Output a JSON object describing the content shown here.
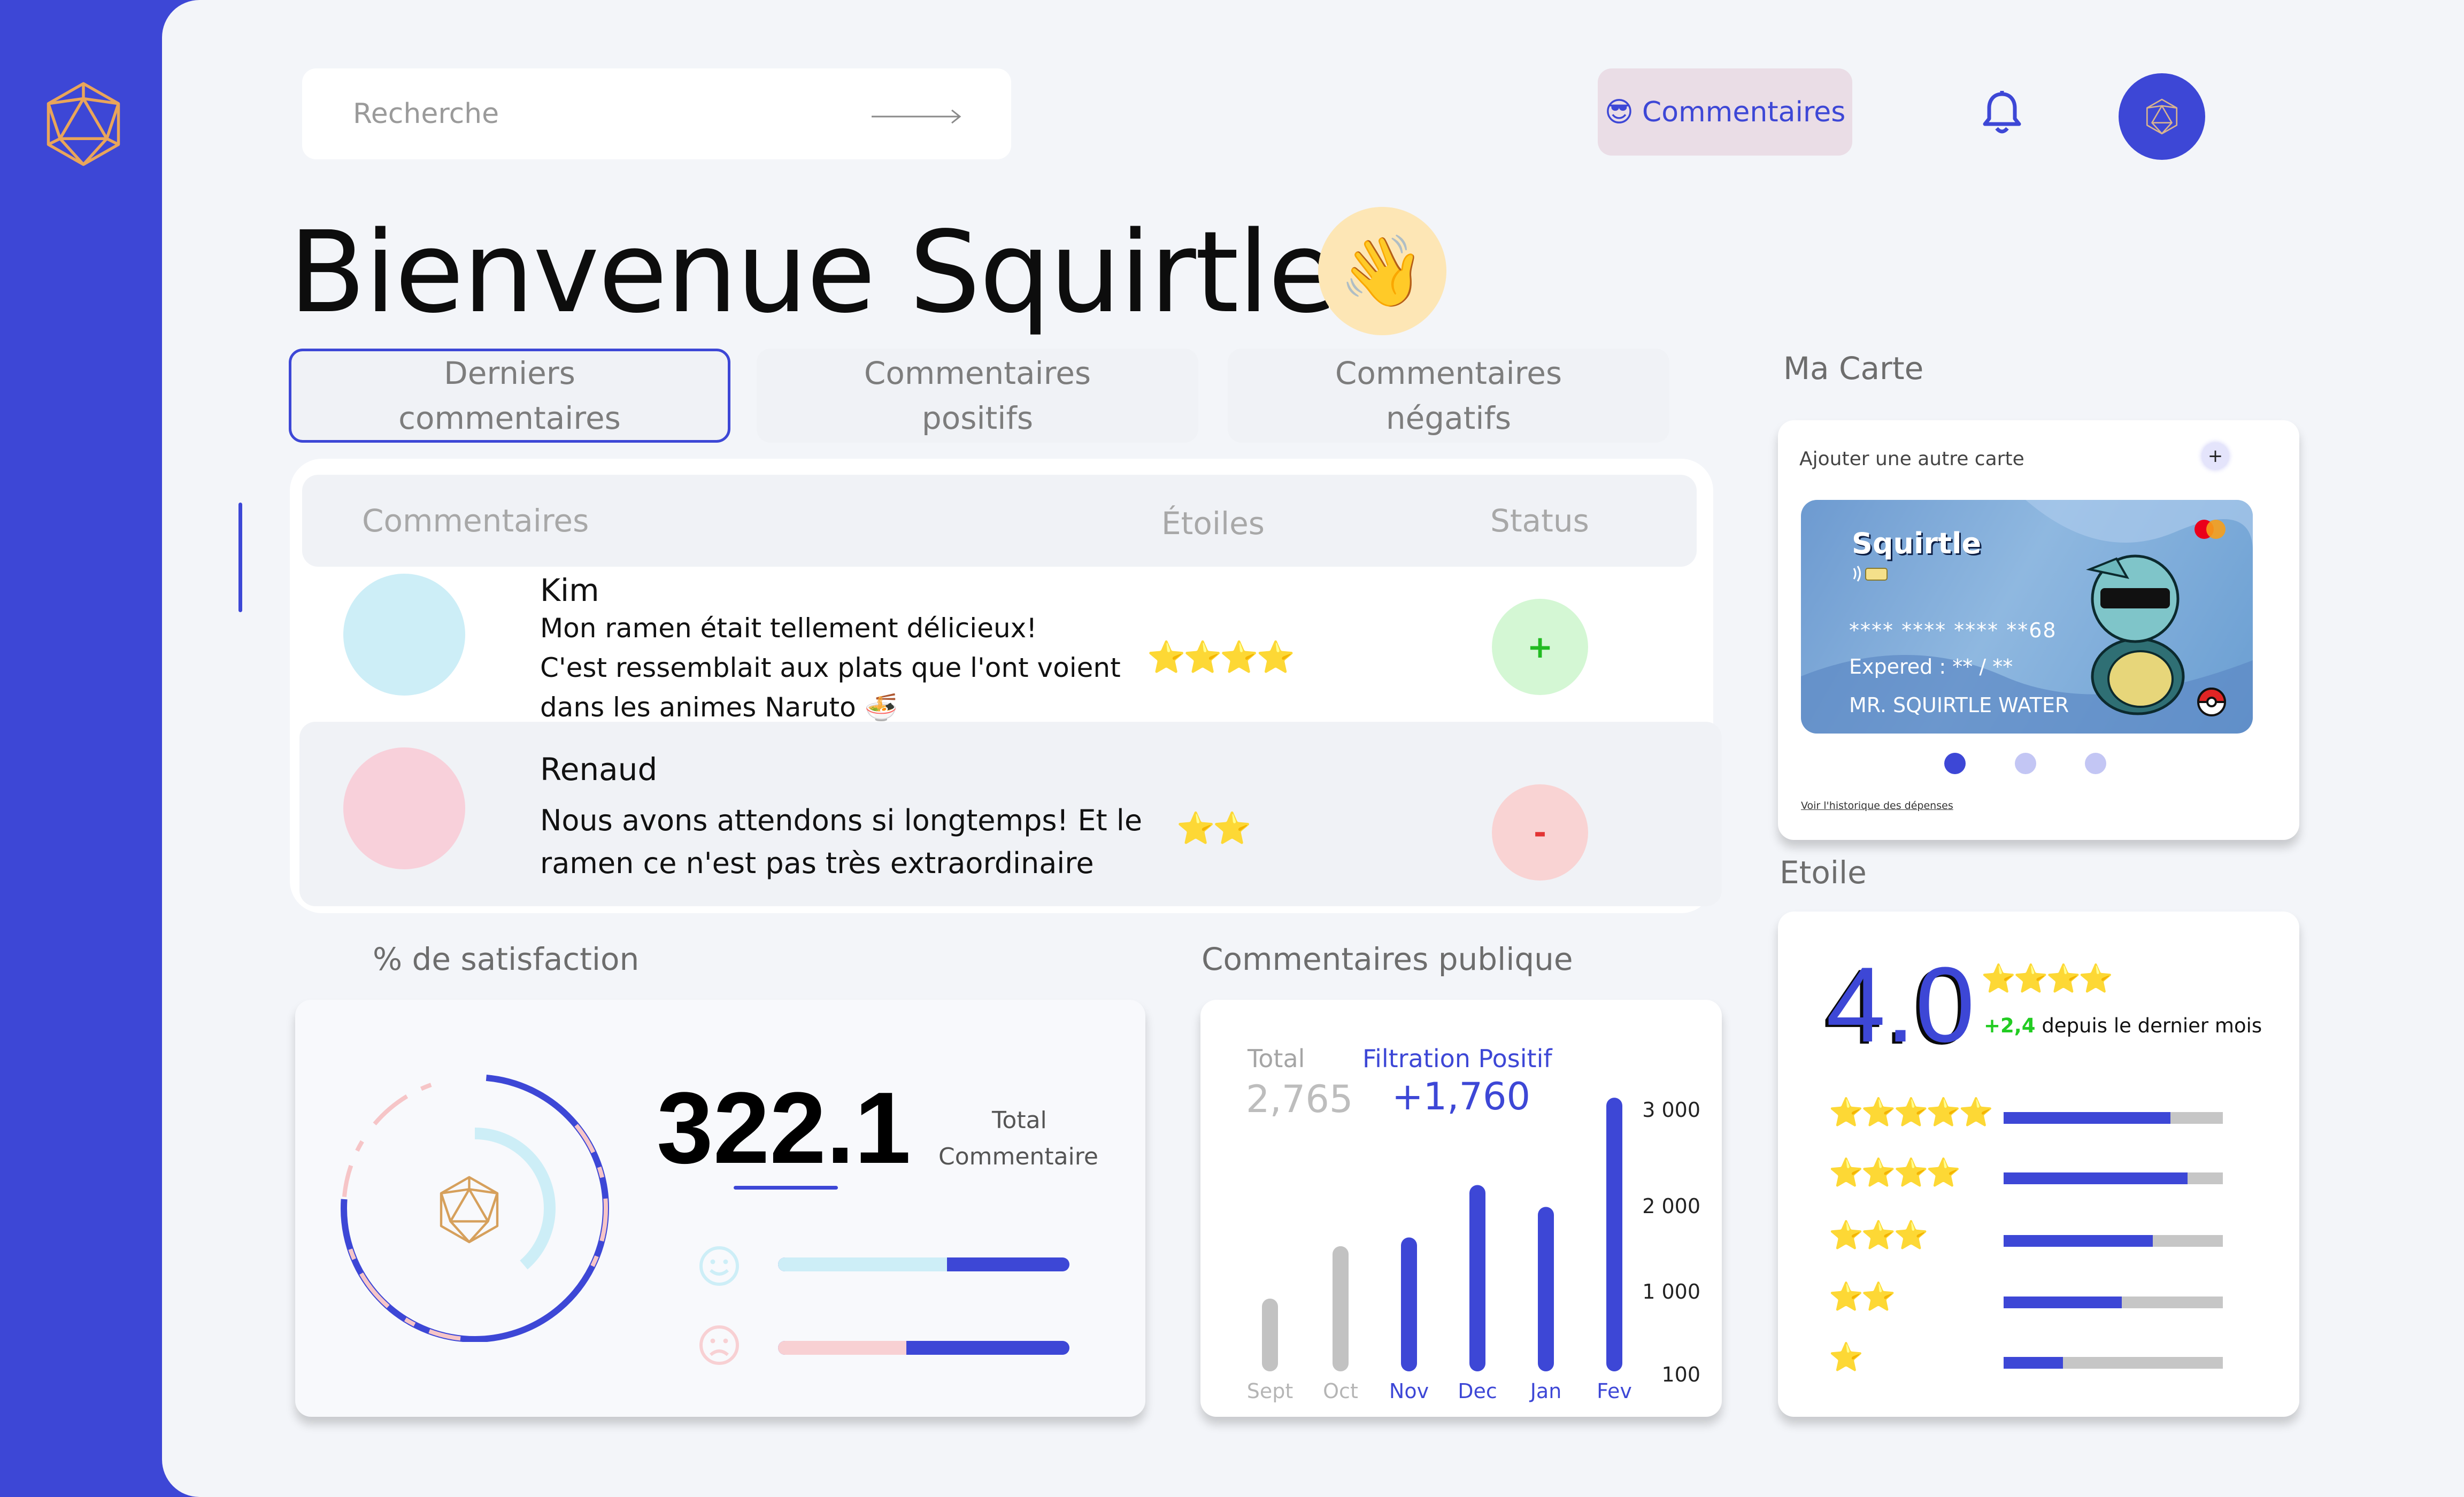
{
  "search": {
    "placeholder": "Recherche"
  },
  "header": {
    "comments_button": "Commentaires",
    "comments_emoji": "😎"
  },
  "welcome": {
    "title": "Bienvenue Squirtle !",
    "emoji": "👋"
  },
  "tabs": [
    {
      "label": "Derniers commentaires",
      "active": true
    },
    {
      "label": "Commentaires positifs",
      "active": false
    },
    {
      "label": "Commentaires négatifs",
      "active": false
    }
  ],
  "table": {
    "headers": {
      "comments": "Commentaires",
      "stars": "Étoiles",
      "status": "Status"
    },
    "rows": [
      {
        "name": "Kim",
        "comment": "Mon ramen était tellement délicieux!\nC'est ressemblait aux plats que l'ont voient\ndans les animes Naruto 🍜",
        "stars": 4,
        "status": "+",
        "avatar_color": "#cdeef7",
        "status_bg": "#d4f7d4",
        "status_color": "#22bb22"
      },
      {
        "name": "Renaud",
        "comment": "Nous avons attendons si longtemps! Et le\nramen ce n'est pas très extraordinaire",
        "stars": 2,
        "status": "-",
        "avatar_color": "#f8d0da",
        "status_bg": "#f9d3d3",
        "status_color": "#e33333"
      }
    ]
  },
  "satisfaction": {
    "label": "% de satisfaction",
    "total_value": "322.1",
    "total_label_1": "Total",
    "total_label_2": "Commentaire",
    "happy_fraction": 0.58,
    "sad_fraction": 0.44
  },
  "public_comments": {
    "label": "Commentaires publique",
    "total_label": "Total",
    "total_value": "2,765",
    "filter_label": "Filtration Positif",
    "filter_value": "+1,760"
  },
  "chart_data": {
    "type": "bar",
    "categories": [
      "Sept",
      "Oct",
      "Nov",
      "Dec",
      "Jan",
      "Fev"
    ],
    "values": [
      650,
      1250,
      1350,
      1950,
      1700,
      2950
    ],
    "highlighted": [
      false,
      false,
      true,
      true,
      true,
      true
    ],
    "y_ticks": [
      "3 000",
      "2 000",
      "1 000",
      "100"
    ],
    "colors": {
      "active": "#3d47d6",
      "inactive": "#c2c2c2"
    }
  },
  "my_card": {
    "label": "Ma Carte",
    "add_card": "Ajouter une autre carte",
    "add_symbol": "+",
    "card_name": "Squirtle",
    "card_number": "**** **** **** **68",
    "expiry": "Expered : ** / **",
    "holder": "MR. SQUIRTLE WATER",
    "history_link": "Voir l'historique des dépenses"
  },
  "rating": {
    "label": "Etoile",
    "score": "4.0",
    "change": "+2,4",
    "change_suffix": "depuis le dernier mois",
    "distribution": [
      {
        "stars": 5,
        "fraction": 0.76
      },
      {
        "stars": 4,
        "fraction": 0.84
      },
      {
        "stars": 3,
        "fraction": 0.68
      },
      {
        "stars": 2,
        "fraction": 0.54
      },
      {
        "stars": 1,
        "fraction": 0.27
      }
    ]
  },
  "colors": {
    "brand": "#3d47d6",
    "star": "#f7c52d"
  }
}
